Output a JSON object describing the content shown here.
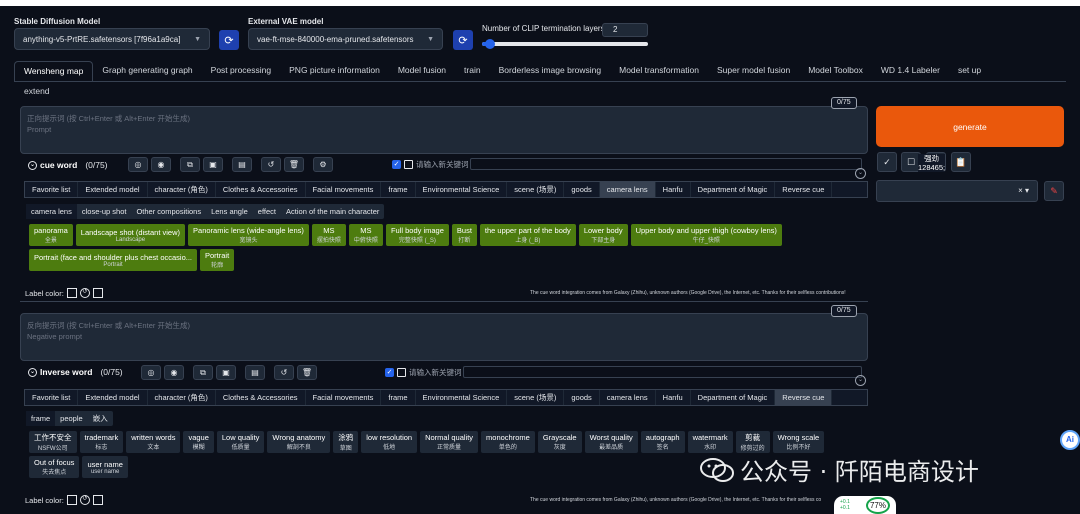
{
  "top": {
    "sd_model_label": "Stable Diffusion Model",
    "sd_model_value": "anything-v5-PrtRE.safetensors [7f96a1a9ca]",
    "vae_label": "External VAE model",
    "vae_value": "vae-ft-mse-840000-ema-pruned.safetensors",
    "clip_label": "Number of CLIP termination layers",
    "clip_value": "2",
    "clip_fraction": 0.05
  },
  "tabs": [
    "Wensheng map",
    "Graph generating graph",
    "Post processing",
    "PNG picture information",
    "Model fusion",
    "train",
    "Borderless image browsing",
    "Model transformation",
    "Super model fusion",
    "Model Toolbox",
    "WD 1.4 Labeler",
    "set up"
  ],
  "tab_extend": "extend",
  "positive": {
    "counter": "0/75",
    "placeholder_zh": "正向提示词 (按 Ctrl+Enter 或 Alt+Enter 开始生成)",
    "placeholder_en": "Prompt",
    "section_title": "cue word",
    "section_count": "(0/75)",
    "new_keyword_placeholder": "请输入新关键词"
  },
  "categories_top": [
    "Favorite list",
    "Extended model",
    "character (角色)",
    "Clothes &#38; Accessories",
    "Facial movements",
    "frame",
    "Environmental Science",
    "scene (场景)",
    "goods",
    "camera lens",
    "Hanfu",
    "Department of Magic",
    "Reverse cue"
  ],
  "subcats_top": [
    "camera lens",
    "close-up shot",
    "Other compositions",
    "Lens angle",
    "effect",
    "Action of the main character"
  ],
  "tags_top": [
    {
      "en": "panorama",
      "zh": "全景"
    },
    {
      "en": "Landscape shot (distant view)",
      "zh": "Landscape"
    },
    {
      "en": "Panoramic lens (wide-angle lens)",
      "zh": "宽镜头"
    },
    {
      "en": "MS",
      "zh": "摆拍快照"
    },
    {
      "en": "MS",
      "zh": "中俯快照"
    },
    {
      "en": "Full body image",
      "zh": "完整快照 (_S)"
    },
    {
      "en": "Bust",
      "zh": "打断"
    },
    {
      "en": "the upper part of the body",
      "zh": "上身 (_B)"
    },
    {
      "en": "Lower body",
      "zh": "下部主身"
    },
    {
      "en": "Upper body and upper thigh (cowboy lens)",
      "zh": "牛仔_快照"
    },
    {
      "en": "Portrait (face and shoulder plus chest occasio...",
      "zh": "Portrait"
    },
    {
      "en": "Portrait",
      "zh": "轮廓"
    }
  ],
  "label_color": "Label color:",
  "credit": "The cue word integration comes from Galaxy (Zhihu), unknown authors (Google Drive), the Internet, etc. Thanks for their selfless contributions!",
  "credit_cut": "The cue word integration comes from Galaxy (Zhihu), unknown authors (Google Drive), the Internet, etc. Thanks for their selfless co",
  "negative": {
    "counter": "0/75",
    "placeholder_zh": "反向提示词 (按 Ctrl+Enter 或 Alt+Enter 开始生成)",
    "placeholder_en": "Negative prompt",
    "section_title": "Inverse word",
    "section_count": "(0/75)",
    "new_keyword_placeholder": "请输入新关键词"
  },
  "categories_bottom": [
    "Favorite list",
    "Extended model",
    "character (角色)",
    "Clothes &#38; Accessories",
    "Facial movements",
    "frame",
    "Environmental Science",
    "scene (场景)",
    "goods",
    "camera lens",
    "Hanfu",
    "Department of Magic",
    "Reverse cue"
  ],
  "subcats_bottom": [
    "frame",
    "people",
    "嵌入"
  ],
  "tags_bottom": [
    {
      "en": "工作不安全",
      "zh": "NSFW公司"
    },
    {
      "en": "trademark",
      "zh": "标志"
    },
    {
      "en": "written words",
      "zh": "文本"
    },
    {
      "en": "vague",
      "zh": "模糊"
    },
    {
      "en": "Low quality",
      "zh": "低质量"
    },
    {
      "en": "Wrong anatomy",
      "zh": "解剖不良"
    },
    {
      "en": "涂鸦",
      "zh": "草图"
    },
    {
      "en": "low resolution",
      "zh": "低地"
    },
    {
      "en": "Normal quality",
      "zh": "正常质量"
    },
    {
      "en": "monochrome",
      "zh": "单色的"
    },
    {
      "en": "Grayscale",
      "zh": "灰度"
    },
    {
      "en": "Worst quality",
      "zh": "最差品质"
    },
    {
      "en": "autograph",
      "zh": "签名"
    },
    {
      "en": "watermark",
      "zh": "水印"
    },
    {
      "en": "剪裁",
      "zh": "修剪过的"
    },
    {
      "en": "Wrong scale",
      "zh": "比例不好"
    },
    {
      "en": "Out of focus",
      "zh": "失去焦点"
    },
    {
      "en": "user name",
      "zh": "user name"
    }
  ],
  "right": {
    "generate": "generate",
    "tooltip_line1": "强劲",
    "tooltip_line2": "128465;",
    "check_icon": "✓",
    "square_icon": "☐",
    "x_icon": "×"
  },
  "watermark": "公众号 · 阡陌电商设计",
  "side_ai": "Ai",
  "net": {
    "up": "+0.1",
    "down": "+0.1",
    "pct": "77%"
  }
}
